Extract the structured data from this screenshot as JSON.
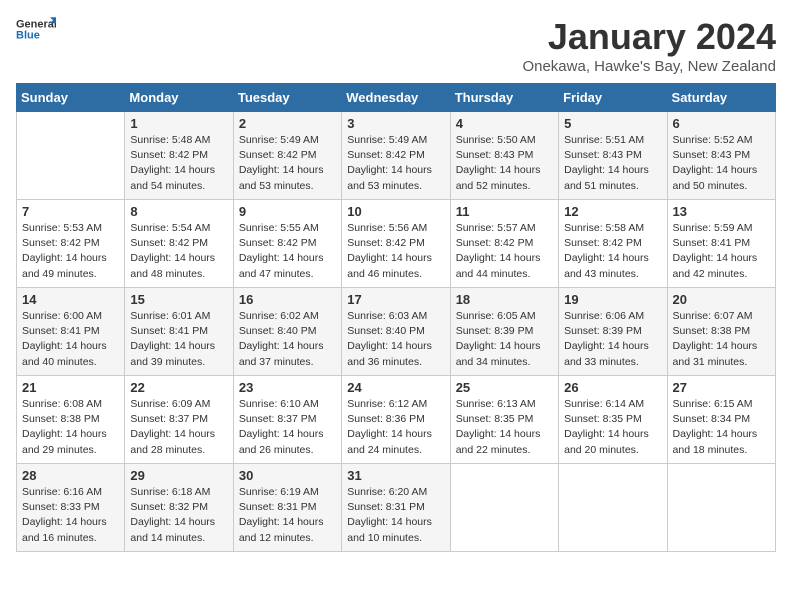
{
  "logo": {
    "general": "General",
    "blue": "Blue"
  },
  "title": "January 2024",
  "subtitle": "Onekawa, Hawke's Bay, New Zealand",
  "days_header": [
    "Sunday",
    "Monday",
    "Tuesday",
    "Wednesday",
    "Thursday",
    "Friday",
    "Saturday"
  ],
  "weeks": [
    [
      {
        "day": "",
        "detail": ""
      },
      {
        "day": "1",
        "detail": "Sunrise: 5:48 AM\nSunset: 8:42 PM\nDaylight: 14 hours\nand 54 minutes."
      },
      {
        "day": "2",
        "detail": "Sunrise: 5:49 AM\nSunset: 8:42 PM\nDaylight: 14 hours\nand 53 minutes."
      },
      {
        "day": "3",
        "detail": "Sunrise: 5:49 AM\nSunset: 8:42 PM\nDaylight: 14 hours\nand 53 minutes."
      },
      {
        "day": "4",
        "detail": "Sunrise: 5:50 AM\nSunset: 8:43 PM\nDaylight: 14 hours\nand 52 minutes."
      },
      {
        "day": "5",
        "detail": "Sunrise: 5:51 AM\nSunset: 8:43 PM\nDaylight: 14 hours\nand 51 minutes."
      },
      {
        "day": "6",
        "detail": "Sunrise: 5:52 AM\nSunset: 8:43 PM\nDaylight: 14 hours\nand 50 minutes."
      }
    ],
    [
      {
        "day": "7",
        "detail": "Sunrise: 5:53 AM\nSunset: 8:42 PM\nDaylight: 14 hours\nand 49 minutes."
      },
      {
        "day": "8",
        "detail": "Sunrise: 5:54 AM\nSunset: 8:42 PM\nDaylight: 14 hours\nand 48 minutes."
      },
      {
        "day": "9",
        "detail": "Sunrise: 5:55 AM\nSunset: 8:42 PM\nDaylight: 14 hours\nand 47 minutes."
      },
      {
        "day": "10",
        "detail": "Sunrise: 5:56 AM\nSunset: 8:42 PM\nDaylight: 14 hours\nand 46 minutes."
      },
      {
        "day": "11",
        "detail": "Sunrise: 5:57 AM\nSunset: 8:42 PM\nDaylight: 14 hours\nand 44 minutes."
      },
      {
        "day": "12",
        "detail": "Sunrise: 5:58 AM\nSunset: 8:42 PM\nDaylight: 14 hours\nand 43 minutes."
      },
      {
        "day": "13",
        "detail": "Sunrise: 5:59 AM\nSunset: 8:41 PM\nDaylight: 14 hours\nand 42 minutes."
      }
    ],
    [
      {
        "day": "14",
        "detail": "Sunrise: 6:00 AM\nSunset: 8:41 PM\nDaylight: 14 hours\nand 40 minutes."
      },
      {
        "day": "15",
        "detail": "Sunrise: 6:01 AM\nSunset: 8:41 PM\nDaylight: 14 hours\nand 39 minutes."
      },
      {
        "day": "16",
        "detail": "Sunrise: 6:02 AM\nSunset: 8:40 PM\nDaylight: 14 hours\nand 37 minutes."
      },
      {
        "day": "17",
        "detail": "Sunrise: 6:03 AM\nSunset: 8:40 PM\nDaylight: 14 hours\nand 36 minutes."
      },
      {
        "day": "18",
        "detail": "Sunrise: 6:05 AM\nSunset: 8:39 PM\nDaylight: 14 hours\nand 34 minutes."
      },
      {
        "day": "19",
        "detail": "Sunrise: 6:06 AM\nSunset: 8:39 PM\nDaylight: 14 hours\nand 33 minutes."
      },
      {
        "day": "20",
        "detail": "Sunrise: 6:07 AM\nSunset: 8:38 PM\nDaylight: 14 hours\nand 31 minutes."
      }
    ],
    [
      {
        "day": "21",
        "detail": "Sunrise: 6:08 AM\nSunset: 8:38 PM\nDaylight: 14 hours\nand 29 minutes."
      },
      {
        "day": "22",
        "detail": "Sunrise: 6:09 AM\nSunset: 8:37 PM\nDaylight: 14 hours\nand 28 minutes."
      },
      {
        "day": "23",
        "detail": "Sunrise: 6:10 AM\nSunset: 8:37 PM\nDaylight: 14 hours\nand 26 minutes."
      },
      {
        "day": "24",
        "detail": "Sunrise: 6:12 AM\nSunset: 8:36 PM\nDaylight: 14 hours\nand 24 minutes."
      },
      {
        "day": "25",
        "detail": "Sunrise: 6:13 AM\nSunset: 8:35 PM\nDaylight: 14 hours\nand 22 minutes."
      },
      {
        "day": "26",
        "detail": "Sunrise: 6:14 AM\nSunset: 8:35 PM\nDaylight: 14 hours\nand 20 minutes."
      },
      {
        "day": "27",
        "detail": "Sunrise: 6:15 AM\nSunset: 8:34 PM\nDaylight: 14 hours\nand 18 minutes."
      }
    ],
    [
      {
        "day": "28",
        "detail": "Sunrise: 6:16 AM\nSunset: 8:33 PM\nDaylight: 14 hours\nand 16 minutes."
      },
      {
        "day": "29",
        "detail": "Sunrise: 6:18 AM\nSunset: 8:32 PM\nDaylight: 14 hours\nand 14 minutes."
      },
      {
        "day": "30",
        "detail": "Sunrise: 6:19 AM\nSunset: 8:31 PM\nDaylight: 14 hours\nand 12 minutes."
      },
      {
        "day": "31",
        "detail": "Sunrise: 6:20 AM\nSunset: 8:31 PM\nDaylight: 14 hours\nand 10 minutes."
      },
      {
        "day": "",
        "detail": ""
      },
      {
        "day": "",
        "detail": ""
      },
      {
        "day": "",
        "detail": ""
      }
    ]
  ]
}
